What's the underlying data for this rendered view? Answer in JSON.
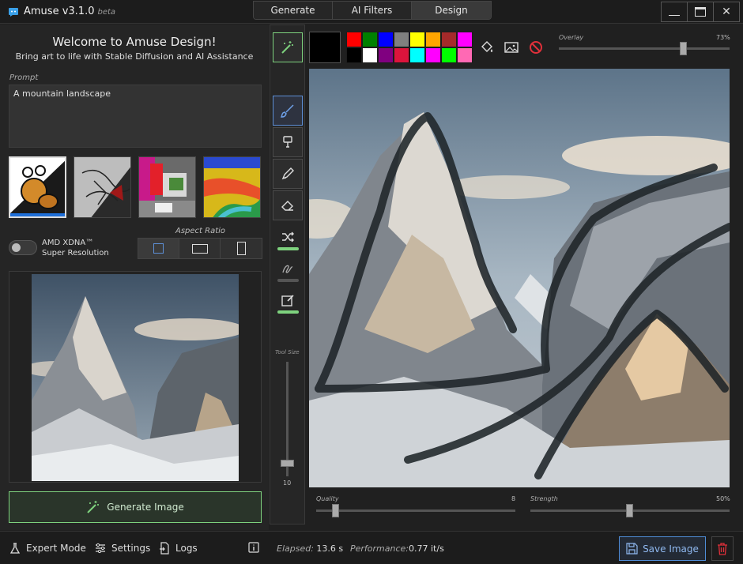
{
  "app": {
    "name": "Amuse v3.1.0",
    "badge": "beta"
  },
  "tabs": [
    {
      "label": "Generate"
    },
    {
      "label": "AI Filters"
    },
    {
      "label": "Design",
      "active": true
    }
  ],
  "window_controls": {
    "minimize": "—",
    "maximize": "▭",
    "close": "✕"
  },
  "left": {
    "welcome_title": "Welcome to Amuse Design!",
    "welcome_subtitle": "Bring art to life with Stable Diffusion and AI Assistance",
    "prompt_label": "Prompt",
    "prompt_value": "A mountain landscape",
    "presets": [
      "sketch-style",
      "line-art-style",
      "color-blocks-style",
      "painted-style"
    ],
    "xdna_label_line1": "AMD XDNA™",
    "xdna_label_line2": "Super Resolution",
    "xdna_enabled": false,
    "aspect_ratio_label": "Aspect Ratio",
    "aspect_options": [
      "square",
      "landscape",
      "portrait"
    ],
    "aspect_selected": "square",
    "generate_label": "Generate Image"
  },
  "toolbar": {
    "tools": [
      "magic-wand",
      "brush",
      "stamp",
      "pen",
      "eraser",
      "shuffle",
      "squiggle",
      "edit"
    ],
    "active_tool": "brush",
    "tool_size_label": "Tool Size",
    "tool_size_value": "10"
  },
  "colors": {
    "current": "#000000",
    "palette": [
      "#ff0000",
      "#008000",
      "#0000ff",
      "#808080",
      "#ffff00",
      "#ffa500",
      "#a52a2a",
      "#ff00ff",
      "#000000",
      "#ffffff",
      "#800080",
      "#dc143c",
      "#00ffff",
      "#ff00ff",
      "#00ff00",
      "#ff69b4"
    ],
    "accent_green": "#7ed27e",
    "accent_blue": "#4f8cd6"
  },
  "overlay": {
    "label": "Overlay",
    "value": "73%",
    "fraction": 0.73
  },
  "quality": {
    "label": "Quality",
    "value": "8",
    "fraction": 0.1
  },
  "strength": {
    "label": "Strength",
    "value": "50%",
    "fraction": 0.5
  },
  "bottom": {
    "expert_mode": "Expert Mode",
    "settings": "Settings",
    "logs": "Logs",
    "elapsed_label": "Elapsed:",
    "elapsed_value": "13.6 s",
    "performance_label": "Performance:",
    "performance_value": "0.77 it/s",
    "save_label": "Save Image"
  }
}
